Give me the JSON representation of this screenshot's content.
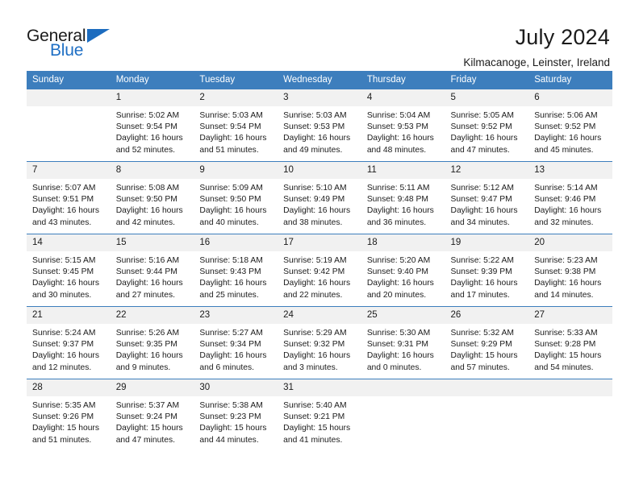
{
  "brand": {
    "name_part1": "General",
    "name_part2": "Blue",
    "accent_color": "#1c6cbf"
  },
  "header": {
    "title": "July 2024",
    "subtitle": "Kilmacanoge, Leinster, Ireland"
  },
  "calendar": {
    "header_bg": "#3d7ebd",
    "weekdays": [
      "Sunday",
      "Monday",
      "Tuesday",
      "Wednesday",
      "Thursday",
      "Friday",
      "Saturday"
    ],
    "weeks": [
      [
        {
          "day": "",
          "sunrise": "",
          "sunset": "",
          "daylight_line1": "",
          "daylight_line2": "",
          "blank": true
        },
        {
          "day": "1",
          "sunrise": "Sunrise: 5:02 AM",
          "sunset": "Sunset: 9:54 PM",
          "daylight_line1": "Daylight: 16 hours",
          "daylight_line2": "and 52 minutes."
        },
        {
          "day": "2",
          "sunrise": "Sunrise: 5:03 AM",
          "sunset": "Sunset: 9:54 PM",
          "daylight_line1": "Daylight: 16 hours",
          "daylight_line2": "and 51 minutes."
        },
        {
          "day": "3",
          "sunrise": "Sunrise: 5:03 AM",
          "sunset": "Sunset: 9:53 PM",
          "daylight_line1": "Daylight: 16 hours",
          "daylight_line2": "and 49 minutes."
        },
        {
          "day": "4",
          "sunrise": "Sunrise: 5:04 AM",
          "sunset": "Sunset: 9:53 PM",
          "daylight_line1": "Daylight: 16 hours",
          "daylight_line2": "and 48 minutes."
        },
        {
          "day": "5",
          "sunrise": "Sunrise: 5:05 AM",
          "sunset": "Sunset: 9:52 PM",
          "daylight_line1": "Daylight: 16 hours",
          "daylight_line2": "and 47 minutes."
        },
        {
          "day": "6",
          "sunrise": "Sunrise: 5:06 AM",
          "sunset": "Sunset: 9:52 PM",
          "daylight_line1": "Daylight: 16 hours",
          "daylight_line2": "and 45 minutes."
        }
      ],
      [
        {
          "day": "7",
          "sunrise": "Sunrise: 5:07 AM",
          "sunset": "Sunset: 9:51 PM",
          "daylight_line1": "Daylight: 16 hours",
          "daylight_line2": "and 43 minutes."
        },
        {
          "day": "8",
          "sunrise": "Sunrise: 5:08 AM",
          "sunset": "Sunset: 9:50 PM",
          "daylight_line1": "Daylight: 16 hours",
          "daylight_line2": "and 42 minutes."
        },
        {
          "day": "9",
          "sunrise": "Sunrise: 5:09 AM",
          "sunset": "Sunset: 9:50 PM",
          "daylight_line1": "Daylight: 16 hours",
          "daylight_line2": "and 40 minutes."
        },
        {
          "day": "10",
          "sunrise": "Sunrise: 5:10 AM",
          "sunset": "Sunset: 9:49 PM",
          "daylight_line1": "Daylight: 16 hours",
          "daylight_line2": "and 38 minutes."
        },
        {
          "day": "11",
          "sunrise": "Sunrise: 5:11 AM",
          "sunset": "Sunset: 9:48 PM",
          "daylight_line1": "Daylight: 16 hours",
          "daylight_line2": "and 36 minutes."
        },
        {
          "day": "12",
          "sunrise": "Sunrise: 5:12 AM",
          "sunset": "Sunset: 9:47 PM",
          "daylight_line1": "Daylight: 16 hours",
          "daylight_line2": "and 34 minutes."
        },
        {
          "day": "13",
          "sunrise": "Sunrise: 5:14 AM",
          "sunset": "Sunset: 9:46 PM",
          "daylight_line1": "Daylight: 16 hours",
          "daylight_line2": "and 32 minutes."
        }
      ],
      [
        {
          "day": "14",
          "sunrise": "Sunrise: 5:15 AM",
          "sunset": "Sunset: 9:45 PM",
          "daylight_line1": "Daylight: 16 hours",
          "daylight_line2": "and 30 minutes."
        },
        {
          "day": "15",
          "sunrise": "Sunrise: 5:16 AM",
          "sunset": "Sunset: 9:44 PM",
          "daylight_line1": "Daylight: 16 hours",
          "daylight_line2": "and 27 minutes."
        },
        {
          "day": "16",
          "sunrise": "Sunrise: 5:18 AM",
          "sunset": "Sunset: 9:43 PM",
          "daylight_line1": "Daylight: 16 hours",
          "daylight_line2": "and 25 minutes."
        },
        {
          "day": "17",
          "sunrise": "Sunrise: 5:19 AM",
          "sunset": "Sunset: 9:42 PM",
          "daylight_line1": "Daylight: 16 hours",
          "daylight_line2": "and 22 minutes."
        },
        {
          "day": "18",
          "sunrise": "Sunrise: 5:20 AM",
          "sunset": "Sunset: 9:40 PM",
          "daylight_line1": "Daylight: 16 hours",
          "daylight_line2": "and 20 minutes."
        },
        {
          "day": "19",
          "sunrise": "Sunrise: 5:22 AM",
          "sunset": "Sunset: 9:39 PM",
          "daylight_line1": "Daylight: 16 hours",
          "daylight_line2": "and 17 minutes."
        },
        {
          "day": "20",
          "sunrise": "Sunrise: 5:23 AM",
          "sunset": "Sunset: 9:38 PM",
          "daylight_line1": "Daylight: 16 hours",
          "daylight_line2": "and 14 minutes."
        }
      ],
      [
        {
          "day": "21",
          "sunrise": "Sunrise: 5:24 AM",
          "sunset": "Sunset: 9:37 PM",
          "daylight_line1": "Daylight: 16 hours",
          "daylight_line2": "and 12 minutes."
        },
        {
          "day": "22",
          "sunrise": "Sunrise: 5:26 AM",
          "sunset": "Sunset: 9:35 PM",
          "daylight_line1": "Daylight: 16 hours",
          "daylight_line2": "and 9 minutes."
        },
        {
          "day": "23",
          "sunrise": "Sunrise: 5:27 AM",
          "sunset": "Sunset: 9:34 PM",
          "daylight_line1": "Daylight: 16 hours",
          "daylight_line2": "and 6 minutes."
        },
        {
          "day": "24",
          "sunrise": "Sunrise: 5:29 AM",
          "sunset": "Sunset: 9:32 PM",
          "daylight_line1": "Daylight: 16 hours",
          "daylight_line2": "and 3 minutes."
        },
        {
          "day": "25",
          "sunrise": "Sunrise: 5:30 AM",
          "sunset": "Sunset: 9:31 PM",
          "daylight_line1": "Daylight: 16 hours",
          "daylight_line2": "and 0 minutes."
        },
        {
          "day": "26",
          "sunrise": "Sunrise: 5:32 AM",
          "sunset": "Sunset: 9:29 PM",
          "daylight_line1": "Daylight: 15 hours",
          "daylight_line2": "and 57 minutes."
        },
        {
          "day": "27",
          "sunrise": "Sunrise: 5:33 AM",
          "sunset": "Sunset: 9:28 PM",
          "daylight_line1": "Daylight: 15 hours",
          "daylight_line2": "and 54 minutes."
        }
      ],
      [
        {
          "day": "28",
          "sunrise": "Sunrise: 5:35 AM",
          "sunset": "Sunset: 9:26 PM",
          "daylight_line1": "Daylight: 15 hours",
          "daylight_line2": "and 51 minutes."
        },
        {
          "day": "29",
          "sunrise": "Sunrise: 5:37 AM",
          "sunset": "Sunset: 9:24 PM",
          "daylight_line1": "Daylight: 15 hours",
          "daylight_line2": "and 47 minutes."
        },
        {
          "day": "30",
          "sunrise": "Sunrise: 5:38 AM",
          "sunset": "Sunset: 9:23 PM",
          "daylight_line1": "Daylight: 15 hours",
          "daylight_line2": "and 44 minutes."
        },
        {
          "day": "31",
          "sunrise": "Sunrise: 5:40 AM",
          "sunset": "Sunset: 9:21 PM",
          "daylight_line1": "Daylight: 15 hours",
          "daylight_line2": "and 41 minutes."
        },
        {
          "day": "",
          "sunrise": "",
          "sunset": "",
          "daylight_line1": "",
          "daylight_line2": "",
          "blank": true
        },
        {
          "day": "",
          "sunrise": "",
          "sunset": "",
          "daylight_line1": "",
          "daylight_line2": "",
          "blank": true
        },
        {
          "day": "",
          "sunrise": "",
          "sunset": "",
          "daylight_line1": "",
          "daylight_line2": "",
          "blank": true
        }
      ]
    ]
  }
}
